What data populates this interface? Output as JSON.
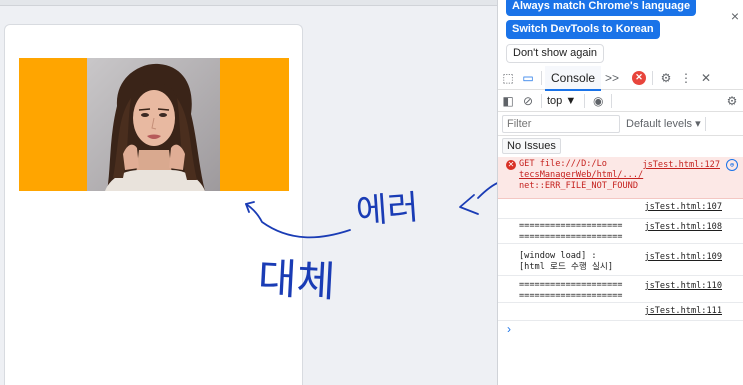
{
  "notification": {
    "match_language": "Always match Chrome's language",
    "switch_language": "Switch DevTools to Korean",
    "dont_show": "Don't show again",
    "close": "×"
  },
  "toolbar": {
    "console_tab": "Console",
    "more_tabs": ">>",
    "error_count": "✕",
    "context": "top ▼",
    "filter_placeholder": "Filter",
    "levels": "Default levels ▾",
    "issues": "No Issues"
  },
  "console": {
    "messages": [
      {
        "type": "error",
        "line1": "GET file:///D:/Lo",
        "line2": "tecsManagerWeb/html/.../",
        "line3": "net::ERR_FILE_NOT_FOUND",
        "source": "jsTest.html:127"
      },
      {
        "type": "log",
        "line1": "",
        "line2": "",
        "source": "jsTest.html:107"
      },
      {
        "type": "log",
        "line1": "====================",
        "line2": "====================",
        "source": "jsTest.html:108"
      },
      {
        "type": "log",
        "line1": "[window load] :",
        "line2": "[html 로드 수행 실시]",
        "source": "jsTest.html:109"
      },
      {
        "type": "log",
        "line1": "====================",
        "line2": "====================",
        "source": "jsTest.html:110"
      },
      {
        "type": "log",
        "line1": "",
        "line2": "",
        "source": "jsTest.html:111"
      }
    ],
    "prompt": "›"
  },
  "annotations": {
    "error_note": "에러",
    "replace_note": "대체"
  },
  "colors": {
    "image_bg": "#ffa500",
    "accent": "#1a73e8",
    "error_bg": "#fce8e6",
    "ink": "#1a3cb5"
  }
}
